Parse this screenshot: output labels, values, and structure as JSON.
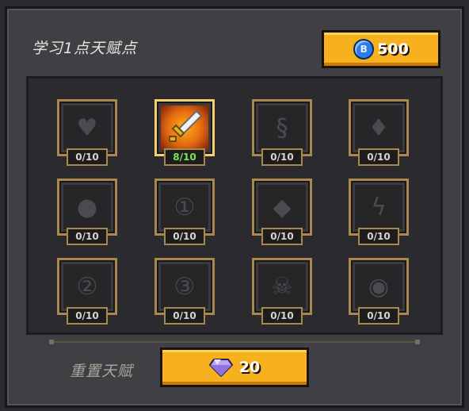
{
  "header": {
    "title": "学习1点天赋点",
    "coins": "500",
    "coin_icon_letter": "B"
  },
  "talents": [
    {
      "icon": "heart-icon",
      "count": "0/10"
    },
    {
      "icon": "sword-icon",
      "count": "8/10"
    },
    {
      "icon": "flame-swirl-icon",
      "count": "0/10"
    },
    {
      "icon": "drop-icon",
      "count": "0/10"
    },
    {
      "icon": "bomb-icon",
      "count": "0/10"
    },
    {
      "icon": "medal-1-icon",
      "count": "0/10"
    },
    {
      "icon": "diamond-shield-icon",
      "count": "0/10"
    },
    {
      "icon": "lightning-shield-icon",
      "count": "0/10"
    },
    {
      "icon": "medal-2-icon",
      "count": "0/10"
    },
    {
      "icon": "medal-3-icon",
      "count": "0/10"
    },
    {
      "icon": "skull-icon",
      "count": "0/10"
    },
    {
      "icon": "eye-icon",
      "count": "0/10"
    }
  ],
  "footer": {
    "reset_label": "重置天赋",
    "reset_cost": "20"
  },
  "colors": {
    "gold": "#f7b11e",
    "frame": "#a9884e",
    "active_count": "#7be650"
  }
}
